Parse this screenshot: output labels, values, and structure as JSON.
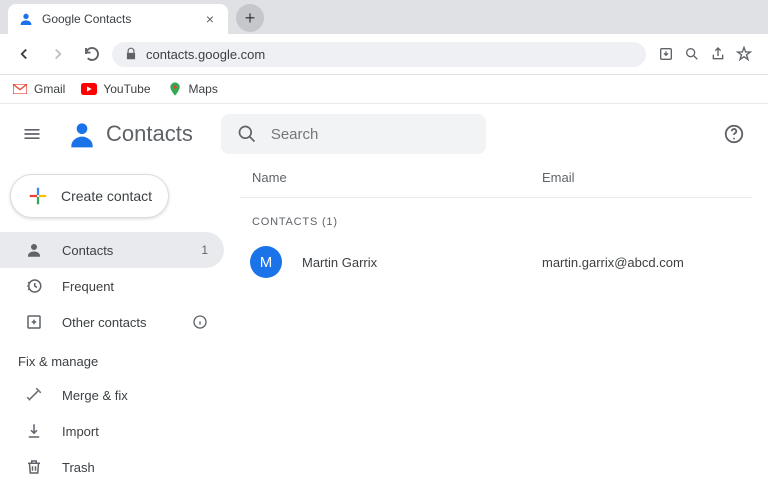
{
  "browser": {
    "tab_title": "Google Contacts",
    "url": "contacts.google.com",
    "bookmarks": [
      {
        "label": "Gmail"
      },
      {
        "label": "YouTube"
      },
      {
        "label": "Maps"
      }
    ]
  },
  "app": {
    "title": "Contacts",
    "search_placeholder": "Search",
    "create_label": "Create contact",
    "nav": {
      "contacts": {
        "label": "Contacts",
        "count": "1"
      },
      "frequent": {
        "label": "Frequent"
      },
      "other": {
        "label": "Other contacts"
      }
    },
    "manage_section": "Fix & manage",
    "manage": {
      "merge": {
        "label": "Merge & fix"
      },
      "import": {
        "label": "Import"
      },
      "trash": {
        "label": "Trash"
      }
    }
  },
  "table": {
    "col_name": "Name",
    "col_email": "Email",
    "group_label": "CONTACTS (1)",
    "rows": [
      {
        "initial": "M",
        "name": "Martin Garrix",
        "email": "martin.garrix@abcd.com"
      }
    ]
  }
}
